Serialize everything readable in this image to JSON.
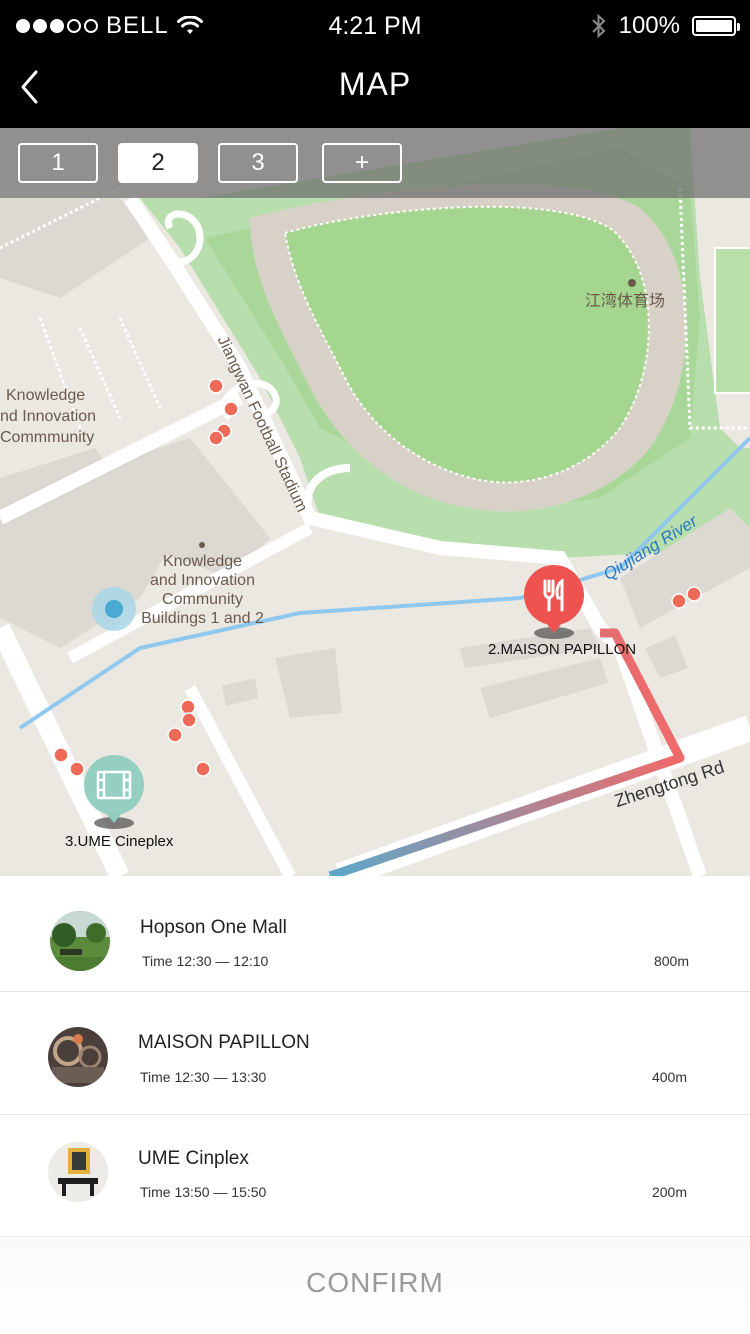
{
  "status_bar": {
    "carrier": "BELL",
    "time": "4:21 PM",
    "battery": "100%",
    "signal_bars_filled": 3,
    "signal_bars_total": 5
  },
  "nav": {
    "title": "MAP",
    "back_icon": "chevron-left-icon"
  },
  "day_tabs": {
    "items": [
      "1",
      "2",
      "3",
      "+"
    ],
    "active_index": 1
  },
  "map": {
    "labels": {
      "stadium_road": "Jiangwan Football Stadium",
      "stadium_cn": "江湾体育场",
      "knowledge_left_1": "Knowledge",
      "knowledge_left_2": "nd Innovation",
      "knowledge_left_3": "Commmunity",
      "knowledge_center_1": "Knowledge",
      "knowledge_center_2": "and Innovation",
      "knowledge_center_3": "Community",
      "knowledge_center_4": "Buildings 1 and 2",
      "river": "Qiujiang River",
      "road": "Zhengtong Rd"
    },
    "pois": {
      "restaurant": "2.MAISON PAPILLON",
      "cinema": "3.UME Cineplex"
    },
    "colors": {
      "route": "#f06a6a",
      "restaurant_pin": "#ef5350",
      "cinema_pin": "#8fcdc0",
      "location_dot": "#5aaed0"
    }
  },
  "places": [
    {
      "name": "Hopson One Mall",
      "time": "Time 12:30 — 12:10",
      "distance": "800m"
    },
    {
      "name": "MAISON PAPILLON",
      "time": "Time 12:30 — 13:30",
      "distance": "400m"
    },
    {
      "name": "UME Cinplex",
      "time": "Time 13:50 — 15:50",
      "distance": "200m"
    }
  ],
  "confirm": {
    "label": "CONFIRM"
  }
}
